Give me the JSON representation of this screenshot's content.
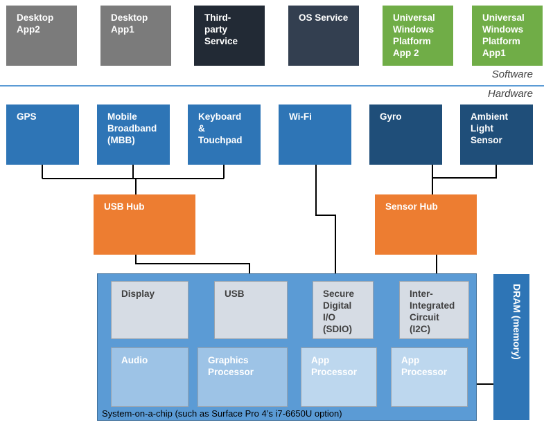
{
  "software": {
    "label": "Software",
    "boxes": [
      {
        "name": "desktop-app2",
        "label": "Desktop\nApp2",
        "color": "#7b7b7b"
      },
      {
        "name": "desktop-app1",
        "label": "Desktop\nApp1",
        "color": "#7b7b7b"
      },
      {
        "name": "third-party-service",
        "label": "Third-\nparty\nService",
        "color": "#222a35"
      },
      {
        "name": "os-service",
        "label": "OS Service",
        "color": "#333f50"
      },
      {
        "name": "uwp-app2",
        "label": "Universal\nWindows\nPlatform\nApp 2",
        "color": "#70ad47"
      },
      {
        "name": "uwp-app1",
        "label": "Universal\nWindows\nPlatform\nApp1",
        "color": "#70ad47"
      }
    ]
  },
  "hardware": {
    "label": "Hardware",
    "devices": [
      {
        "name": "gps",
        "label": "GPS"
      },
      {
        "name": "mbb",
        "label": "Mobile\nBroadband\n(MBB)"
      },
      {
        "name": "keyboard-touchpad",
        "label": "Keyboard\n&\nTouchpad"
      },
      {
        "name": "wifi",
        "label": "Wi-Fi"
      },
      {
        "name": "gyro",
        "label": "Gyro"
      },
      {
        "name": "ambient-light-sensor",
        "label": "Ambient\nLight\nSensor"
      }
    ],
    "hubs": [
      {
        "name": "usb-hub",
        "label": "USB Hub"
      },
      {
        "name": "sensor-hub",
        "label": "Sensor Hub"
      }
    ],
    "soc": {
      "label": "System-on-a-chip (such as Surface Pro 4’s i7-6650U option)",
      "io": [
        {
          "name": "display",
          "label": "Display"
        },
        {
          "name": "usb",
          "label": "USB"
        },
        {
          "name": "sdio",
          "label": "Secure\nDigital\nI/O\n(SDIO)"
        },
        {
          "name": "i2c",
          "label": "Inter-\nIntegrated\nCircuit\n(I2C)"
        }
      ],
      "processors": [
        {
          "name": "audio",
          "label": "Audio"
        },
        {
          "name": "graphics-processor",
          "label": "Graphics\nProcessor"
        },
        {
          "name": "app-processor-1",
          "label": "App\nProcessor"
        },
        {
          "name": "app-processor-2",
          "label": "App\nProcessor"
        }
      ]
    },
    "dram": {
      "label": "DRAM (memory)"
    }
  },
  "colors": {
    "desktop": "#7b7b7b",
    "service_dark": "#222a35",
    "service_slate": "#333f50",
    "uwp": "#70ad47",
    "peripheral": "#2e75b6",
    "sensor": "#1f4e79",
    "hub": "#ed7d31",
    "soc": "#5b9bd5",
    "divider": "#5b9bd5"
  }
}
